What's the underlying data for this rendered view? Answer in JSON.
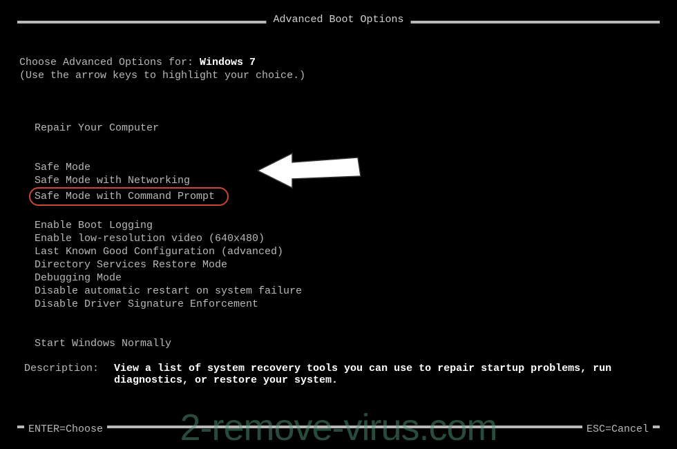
{
  "title": "Advanced Boot Options",
  "prompt": {
    "label": "Choose Advanced Options for: ",
    "os": "Windows 7",
    "hint": "(Use the arrow keys to highlight your choice.)"
  },
  "menu": {
    "repair": "Repair Your Computer",
    "group1": [
      "Safe Mode",
      "Safe Mode with Networking",
      "Safe Mode with Command Prompt"
    ],
    "group2": [
      "Enable Boot Logging",
      "Enable low-resolution video (640x480)",
      "Last Known Good Configuration (advanced)",
      "Directory Services Restore Mode",
      "Debugging Mode",
      "Disable automatic restart on system failure",
      "Disable Driver Signature Enforcement"
    ],
    "normal": "Start Windows Normally"
  },
  "description": {
    "label": "Description:",
    "text": "View a list of system recovery tools you can use to repair startup problems, run diagnostics, or restore your system."
  },
  "footer": {
    "enter": "ENTER=Choose",
    "esc": "ESC=Cancel"
  },
  "watermark": "2-remove-virus.com"
}
